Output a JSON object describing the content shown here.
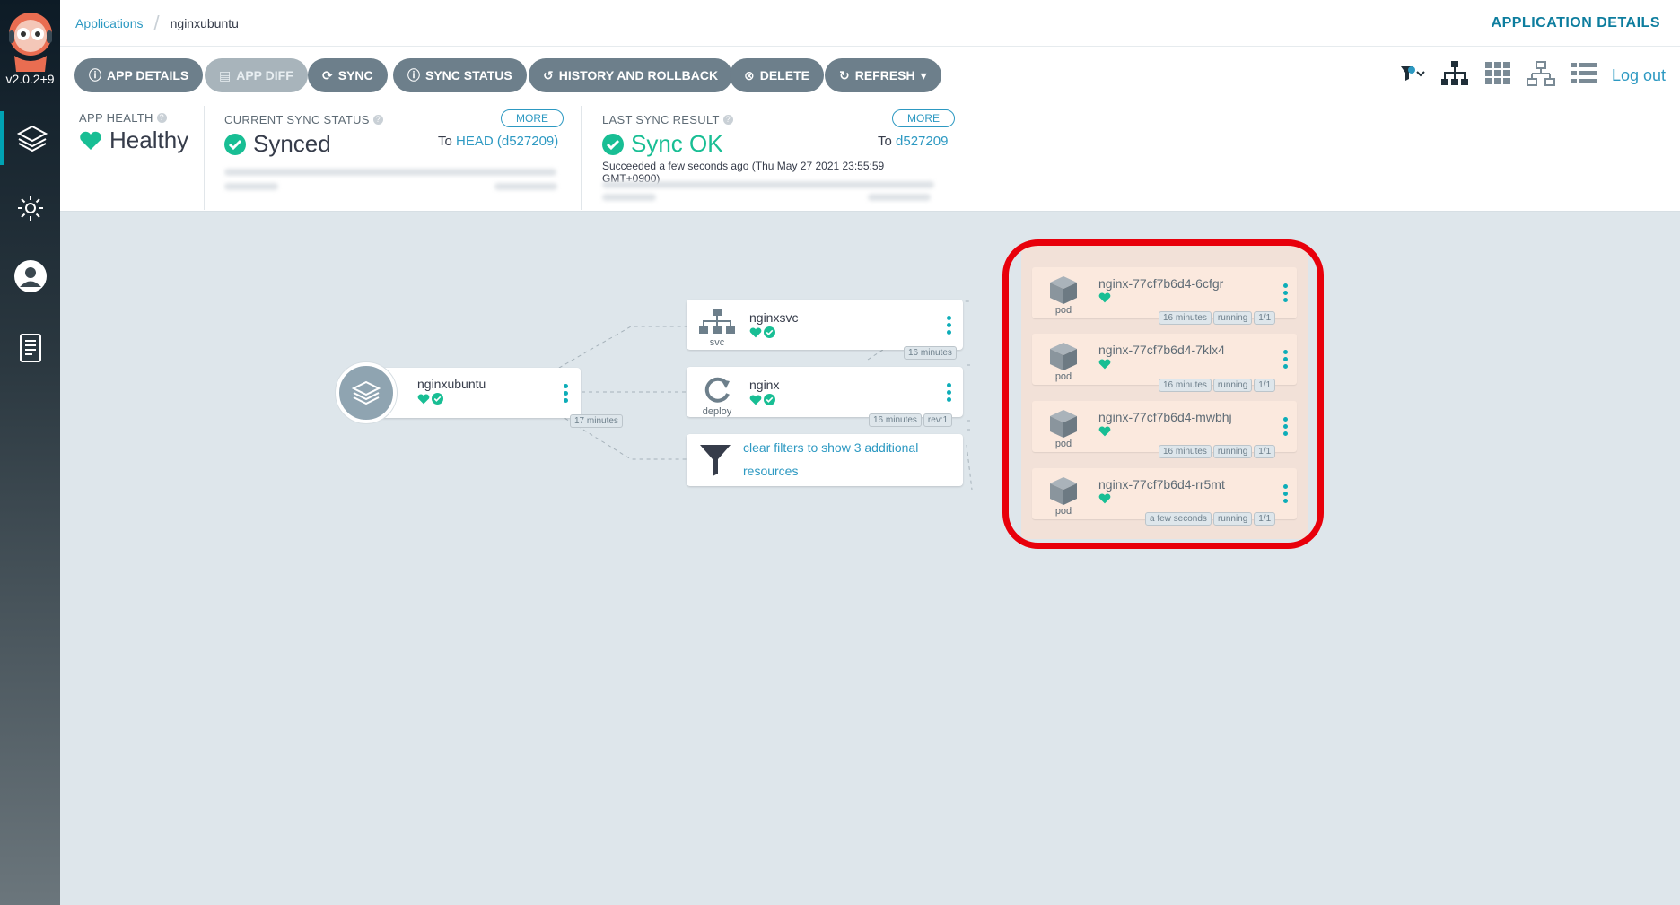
{
  "app": {
    "version": "v2.0.2+9"
  },
  "breadcrumb": {
    "parent": "Applications",
    "current": "nginxubuntu"
  },
  "page_title": "APPLICATION DETAILS",
  "toolbar": {
    "buttons": [
      {
        "label": "APP DETAILS",
        "icon": "info-icon"
      },
      {
        "label": "APP DIFF",
        "icon": "file-diff-icon"
      },
      {
        "label": "SYNC",
        "icon": "sync-icon"
      },
      {
        "label": "SYNC STATUS",
        "icon": "info-icon"
      },
      {
        "label": "HISTORY AND ROLLBACK",
        "icon": "history-icon"
      },
      {
        "label": "DELETE",
        "icon": "times-circle-icon"
      },
      {
        "label": "REFRESH",
        "icon": "refresh-icon"
      }
    ],
    "logout": "Log out"
  },
  "status": {
    "health": {
      "label": "APP HEALTH",
      "value": "Healthy"
    },
    "sync": {
      "label": "CURRENT SYNC STATUS",
      "value": "Synced",
      "more": "MORE",
      "to_prefix": "To",
      "to_ref": "HEAD (d527209)"
    },
    "last_sync": {
      "label": "LAST SYNC RESULT",
      "value": "Sync OK",
      "more": "MORE",
      "to_prefix": "To",
      "to_ref": "d527209",
      "detail": "Succeeded a few seconds ago (Thu May 27 2021 23:55:59 GMT+0900)"
    }
  },
  "graph": {
    "app_node": {
      "name": "nginxubuntu",
      "age": "17 minutes"
    },
    "svc_node": {
      "name": "nginxsvc",
      "kind": "svc",
      "age": "16 minutes"
    },
    "deploy_node": {
      "name": "nginx",
      "kind": "deploy",
      "age": "16 minutes",
      "rev": "rev:1"
    },
    "filter_node": {
      "line1": "clear filters to show 3 additional",
      "line2": "resources"
    },
    "pods": [
      {
        "name": "nginx-77cf7b6d4-6cfgr",
        "kind": "pod",
        "age": "16 minutes",
        "state": "running",
        "ready": "1/1"
      },
      {
        "name": "nginx-77cf7b6d4-7klx4",
        "kind": "pod",
        "age": "16 minutes",
        "state": "running",
        "ready": "1/1"
      },
      {
        "name": "nginx-77cf7b6d4-mwbhj",
        "kind": "pod",
        "age": "16 minutes",
        "state": "running",
        "ready": "1/1"
      },
      {
        "name": "nginx-77cf7b6d4-rr5mt",
        "kind": "pod",
        "age": "a few seconds",
        "state": "running",
        "ready": "1/1"
      }
    ]
  },
  "colors": {
    "healthy": "#18be94",
    "link": "#2d99c2",
    "highlight": "#e8000b",
    "pod_bg": "#fbe9de"
  }
}
